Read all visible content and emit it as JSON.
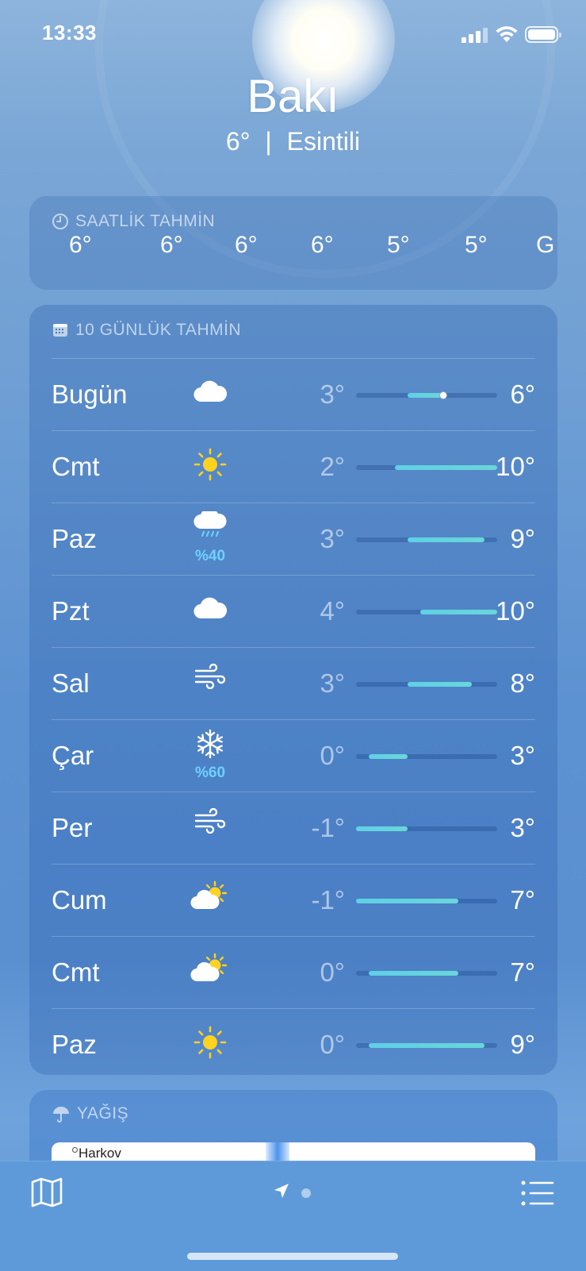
{
  "status": {
    "time": "13:33"
  },
  "header": {
    "city": "Bakı",
    "temp": "6°",
    "separator": "|",
    "condition": "Esintili"
  },
  "hourly": {
    "title": "SAATLİK TAHMİN",
    "temps": [
      "6°",
      "6°",
      "6°",
      "6°",
      "5°",
      "5°",
      "G"
    ]
  },
  "daily": {
    "title": "10 GÜNLÜK TAHMİN",
    "range": {
      "min": -1,
      "max": 10
    },
    "days": [
      {
        "day": "Bugün",
        "icon": "cloud-icon",
        "precip": "",
        "low": "3°",
        "high": "6°",
        "lo": 3,
        "hi": 6,
        "current": 6
      },
      {
        "day": "Cmt",
        "icon": "sun-icon",
        "precip": "",
        "low": "2°",
        "high": "10°",
        "lo": 2,
        "hi": 10
      },
      {
        "day": "Paz",
        "icon": "cloud-rain-icon",
        "precip": "%40",
        "low": "3°",
        "high": "9°",
        "lo": 3,
        "hi": 9
      },
      {
        "day": "Pzt",
        "icon": "cloud-icon",
        "precip": "",
        "low": "4°",
        "high": "10°",
        "lo": 4,
        "hi": 10
      },
      {
        "day": "Sal",
        "icon": "wind-icon",
        "precip": "",
        "low": "3°",
        "high": "8°",
        "lo": 3,
        "hi": 8
      },
      {
        "day": "Çar",
        "icon": "snowflake-icon",
        "precip": "%60",
        "low": "0°",
        "high": "3°",
        "lo": 0,
        "hi": 3
      },
      {
        "day": "Per",
        "icon": "wind-icon",
        "precip": "",
        "low": "-1°",
        "high": "3°",
        "lo": -1,
        "hi": 3
      },
      {
        "day": "Cum",
        "icon": "partly-cloudy-icon",
        "precip": "",
        "low": "-1°",
        "high": "7°",
        "lo": -1,
        "hi": 7
      },
      {
        "day": "Cmt",
        "icon": "partly-cloudy-icon",
        "precip": "",
        "low": "0°",
        "high": "7°",
        "lo": 0,
        "hi": 7
      },
      {
        "day": "Paz",
        "icon": "sun-icon",
        "precip": "",
        "low": "0°",
        "high": "9°",
        "lo": 0,
        "hi": 9
      }
    ]
  },
  "precipitation": {
    "title": "YAĞIŞ",
    "map_label": "Harkov"
  },
  "colors": {
    "precip_text": "#6ed0ff",
    "bar": "#5fd0e6",
    "tab_bg": "#5e9ad9"
  }
}
